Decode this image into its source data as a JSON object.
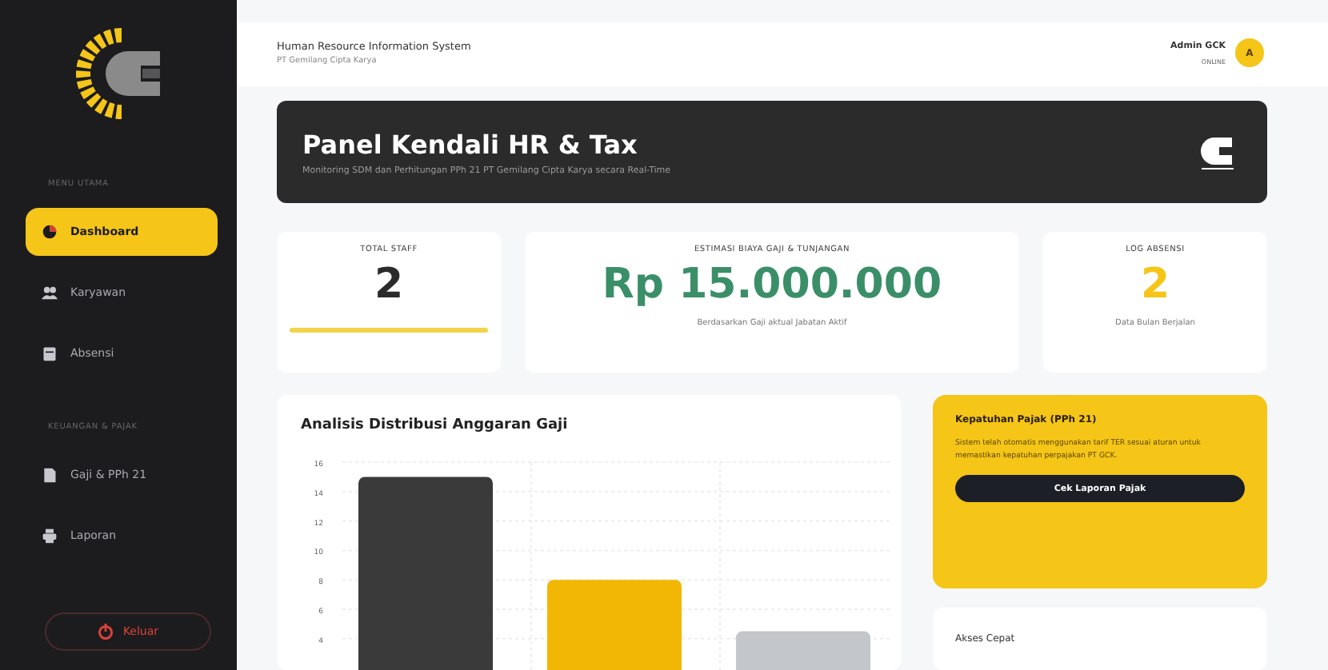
{
  "sidebar": {
    "sections": [
      {
        "label": "MENU UTAMA",
        "items": [
          {
            "label": "Dashboard",
            "kind": "pie",
            "selected": true
          },
          {
            "label": "Karyawan",
            "kind": "users",
            "selected": false
          },
          {
            "label": "Absensi",
            "kind": "calendar",
            "selected": false
          }
        ]
      },
      {
        "label": "KEUANGAN & PAJAK",
        "items": [
          {
            "label": "Gaji & PPh 21",
            "kind": "file",
            "selected": false
          },
          {
            "label": "Laporan",
            "kind": "print",
            "selected": false
          }
        ]
      }
    ],
    "logout": "Keluar"
  },
  "header": {
    "title": "Human Resource Information System",
    "subtitle": "PT Gemilang Cipta Karya",
    "user": {
      "name": "Admin GCK",
      "status": "ONLINE",
      "initial": "A"
    }
  },
  "banner": {
    "title": "Panel Kendali HR & Tax",
    "subtitle": "Monitoring SDM dan Perhitungan PPh 21 PT Gemilang Cipta Karya secara Real-Time"
  },
  "stats": [
    {
      "label": "TOTAL STAFF",
      "value": "2",
      "kind": "bar"
    },
    {
      "label": "ESTIMASI BIAYA GAJI & TUNJANGAN",
      "value": "Rp 15.000.000",
      "note": "Berdasarkan Gaji aktual Jabatan Aktif",
      "kind": "money"
    },
    {
      "label": "LOG ABSENSI",
      "value": "2",
      "note": "Data Bulan Berjalan",
      "kind": "accent"
    }
  ],
  "chart": {
    "title": "Analisis Distribusi Anggaran Gaji",
    "chart_data": {
      "type": "bar",
      "values": [
        15,
        8,
        4.5
      ],
      "ylim": [
        0,
        16
      ],
      "grid": true,
      "yticks": [
        4,
        6,
        8,
        10,
        12,
        14,
        16
      ]
    }
  },
  "tax_card": {
    "title": "Kepatuhan Pajak (PPh 21)",
    "text": "Sistem telah otomatis menggunakan tarif TER sesuai aturan untuk memastikan kepatuhan perpajakan PT GCK.",
    "button": "Cek Laporan Pajak"
  },
  "quick_access": {
    "title": "Akses Cepat"
  }
}
